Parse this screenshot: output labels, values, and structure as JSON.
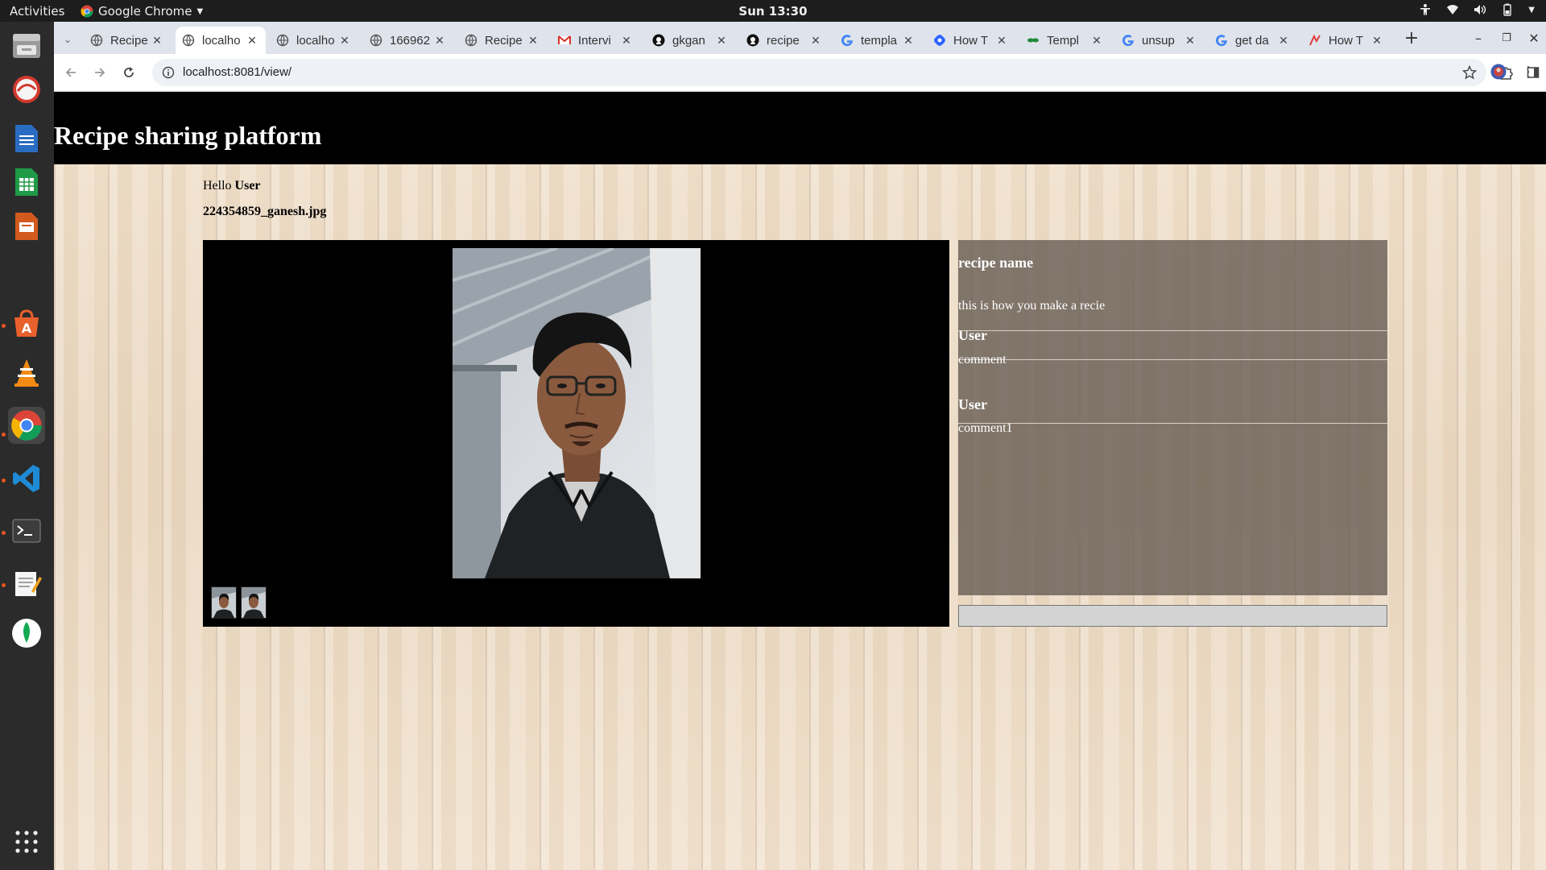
{
  "topbar": {
    "activities": "Activities",
    "app_name": "Google Chrome",
    "clock": "Sun 13:30"
  },
  "dock": {
    "apps": [
      {
        "name": "files-icon"
      },
      {
        "name": "shotwell-icon"
      },
      {
        "name": "writer-icon"
      },
      {
        "name": "calc-icon"
      },
      {
        "name": "impress-icon"
      },
      {
        "name": "app-store-icon"
      },
      {
        "name": "vlc-icon"
      },
      {
        "name": "chrome-icon"
      },
      {
        "name": "vscode-icon"
      },
      {
        "name": "terminal-icon"
      },
      {
        "name": "text-editor-icon"
      },
      {
        "name": "mongodb-compass-icon"
      },
      {
        "name": "app-grid-icon"
      }
    ]
  },
  "tabs": [
    {
      "label": "Recipe",
      "icon": "globe-icon",
      "active": false
    },
    {
      "label": "localho",
      "icon": "globe-icon",
      "active": true
    },
    {
      "label": "localho",
      "icon": "globe-icon",
      "active": false
    },
    {
      "label": "166962",
      "icon": "globe-icon",
      "active": false
    },
    {
      "label": "Recipe",
      "icon": "globe-icon",
      "active": false
    },
    {
      "label": "Intervi",
      "icon": "gmail-icon",
      "active": false
    },
    {
      "label": "gkgan",
      "icon": "github-icon",
      "active": false
    },
    {
      "label": "recipe",
      "icon": "github-icon",
      "active": false
    },
    {
      "label": "templa",
      "icon": "google-icon",
      "active": false
    },
    {
      "label": "How T",
      "icon": "hashnode-icon",
      "active": false
    },
    {
      "label": "Templ",
      "icon": "thymeleaf-icon",
      "active": false
    },
    {
      "label": "unsup",
      "icon": "google-icon",
      "active": false
    },
    {
      "label": "get da",
      "icon": "google-icon",
      "active": false
    },
    {
      "label": "How T",
      "icon": "medium-icon",
      "active": false
    }
  ],
  "toolbar": {
    "url": "localhost:8081/view/"
  },
  "page": {
    "site_title": "Recipe sharing platform",
    "greeting_prefix": "Hello",
    "greeting_user": "User",
    "filename": "224354859_ganesh.jpg",
    "recipe_name": "recipe name",
    "recipe_description": "this is how you make a recie",
    "comments": [
      {
        "user": "User",
        "text": "comment"
      },
      {
        "user": "User",
        "text": "comment1"
      }
    ],
    "comment_input_value": "",
    "thumbnail_count": 2
  },
  "colors": {
    "header_bg": "#000000",
    "panel_bg": "#69605a",
    "tabstrip_bg": "#dfe3eb",
    "dock_bg": "#2b2b2b"
  }
}
